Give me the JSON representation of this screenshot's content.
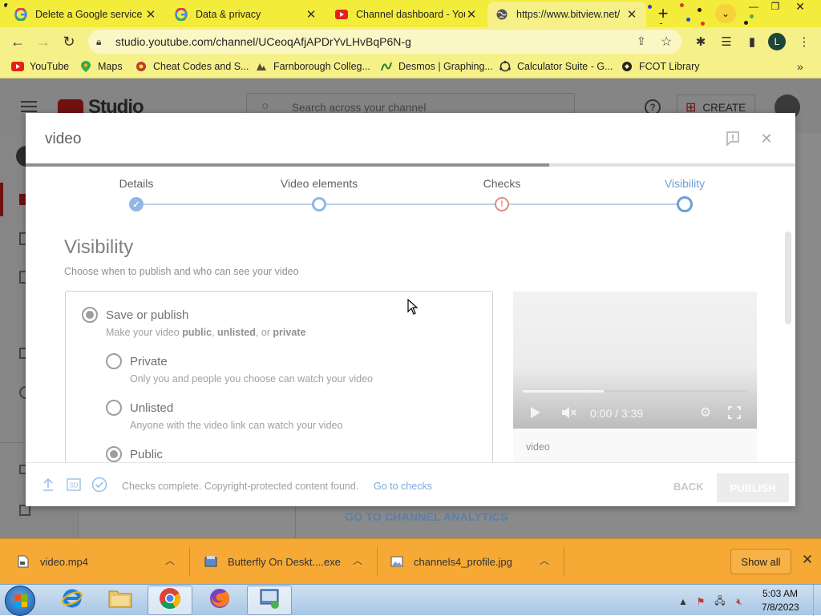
{
  "browser": {
    "tabs": [
      {
        "title": "Delete a Google service",
        "favicon": "google-g-icon"
      },
      {
        "title": "Data & privacy",
        "favicon": "google-g-icon"
      },
      {
        "title": "Channel dashboard - You",
        "favicon": "youtube-icon"
      },
      {
        "title": "https://www.bitview.net/",
        "favicon": "globe-icon"
      }
    ],
    "url": "studio.youtube.com/channel/UCeoqAfjAPDrYvLHvBqP6N-g",
    "profile_initial": "L",
    "bookmarks": [
      {
        "label": "YouTube",
        "icon": "youtube-icon"
      },
      {
        "label": "Maps",
        "icon": "maps-pin-icon"
      },
      {
        "label": "Cheat Codes and S...",
        "icon": "cheat-codes-icon"
      },
      {
        "label": "Farnborough Colleg...",
        "icon": "college-icon"
      },
      {
        "label": "Desmos | Graphing...",
        "icon": "desmos-icon"
      },
      {
        "label": "Calculator Suite - G...",
        "icon": "calculator-icon"
      },
      {
        "label": "FCOT Library",
        "icon": "library-icon"
      }
    ]
  },
  "studio_behind": {
    "logo_text": "Studio",
    "search_placeholder": "Search across your channel",
    "create_label": "CREATE",
    "analytics_link": "GO TO CHANNEL ANALYTICS"
  },
  "modal": {
    "title": "video",
    "progress_fraction": 0.68,
    "steps": [
      {
        "label": "Details",
        "state": "done"
      },
      {
        "label": "Video elements",
        "state": "pending"
      },
      {
        "label": "Checks",
        "state": "warning"
      },
      {
        "label": "Visibility",
        "state": "current"
      }
    ],
    "visibility_title": "Visibility",
    "visibility_subtitle": "Choose when to publish and who can see your video",
    "save_or_publish": {
      "label": "Save or publish",
      "desc_prefix": "Make your video ",
      "desc_public": "public",
      "desc_sep1": ", ",
      "desc_unlisted": "unlisted",
      "desc_sep2": ", or ",
      "desc_private": "private"
    },
    "options": [
      {
        "label": "Private",
        "desc": "Only you and people you choose can watch your video",
        "selected": false
      },
      {
        "label": "Unlisted",
        "desc": "Anyone with the video link can watch your video",
        "selected": false
      },
      {
        "label": "Public",
        "desc": "",
        "selected": true
      }
    ],
    "player": {
      "time": "0:00 / 3:39",
      "played_fraction": 0
    },
    "video_label": "video",
    "footer": {
      "status": "Checks complete. Copyright-protected content found.",
      "link": "Go to checks",
      "back": "BACK",
      "publish": "PUBLISH"
    }
  },
  "downloads": {
    "items": [
      {
        "name": "video.mp4",
        "icon": "video-file-icon"
      },
      {
        "name": "Butterfly On Deskt....exe",
        "icon": "exe-file-icon"
      },
      {
        "name": "channels4_profile.jpg",
        "icon": "image-file-icon"
      }
    ],
    "show_all": "Show all"
  },
  "taskbar": {
    "time": "5:03 AM",
    "date": "7/8/2023"
  }
}
